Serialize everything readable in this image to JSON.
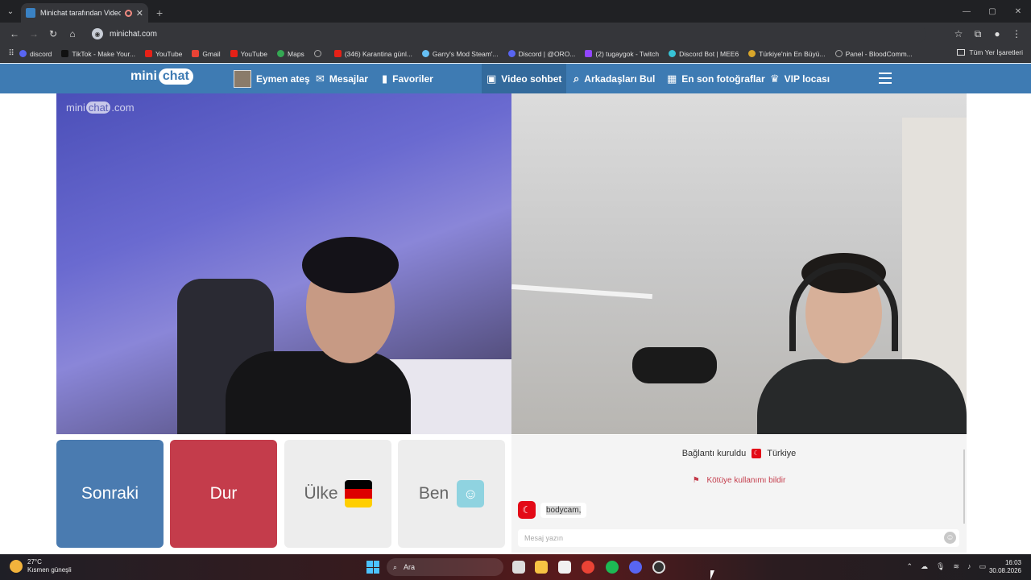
{
  "browser": {
    "tab_title": "Minichat tarafından Video sohbet",
    "url": "minichat.com",
    "bookmarks": [
      "discord",
      "TikTok - Make Your...",
      "YouTube",
      "Gmail",
      "YouTube",
      "Maps",
      "(346) Karantina günl...",
      "Garry's Mod Steam'...",
      "Discord | @ORO...",
      "(2) tugaygok - Twitch",
      "Discord Bot | MEE6",
      "Türkiye'nin En Büyü...",
      "Panel - BloodComm..."
    ],
    "all_bookmarks_label": "Tüm Yer İşaretleri"
  },
  "site": {
    "logo_main": "mini",
    "logo_bubble": "chat",
    "nav": {
      "user": "Eymen ateş",
      "messages": "Mesajlar",
      "favorites": "Favoriler",
      "video_chat": "Video sohbet",
      "find_friends": "Arkadaşları Bul",
      "latest_photos": "En son fotoğraflar",
      "vip": "VIP locası"
    },
    "watermark": {
      "pre": "mini",
      "bubble": "chat",
      "post": ".com"
    }
  },
  "controls": {
    "next": "Sonraki",
    "stop": "Dur",
    "country": "Ülke",
    "me": "Ben"
  },
  "chat": {
    "connected": "Bağlantı kuruldu",
    "country_name": "Türkiye",
    "report": "Kötüye kullanımı bildir",
    "message_text": "bodycam,",
    "input_placeholder": "Mesaj yazın"
  },
  "taskbar": {
    "temperature": "27°C",
    "weather": "Kısmen güneşli",
    "search": "Ara",
    "time": "16:03",
    "date": "30.08.2026"
  },
  "colors": {
    "nav_blue": "#3e7bb3",
    "next_button": "#4a7bb0",
    "stop_button": "#c43c4b"
  }
}
